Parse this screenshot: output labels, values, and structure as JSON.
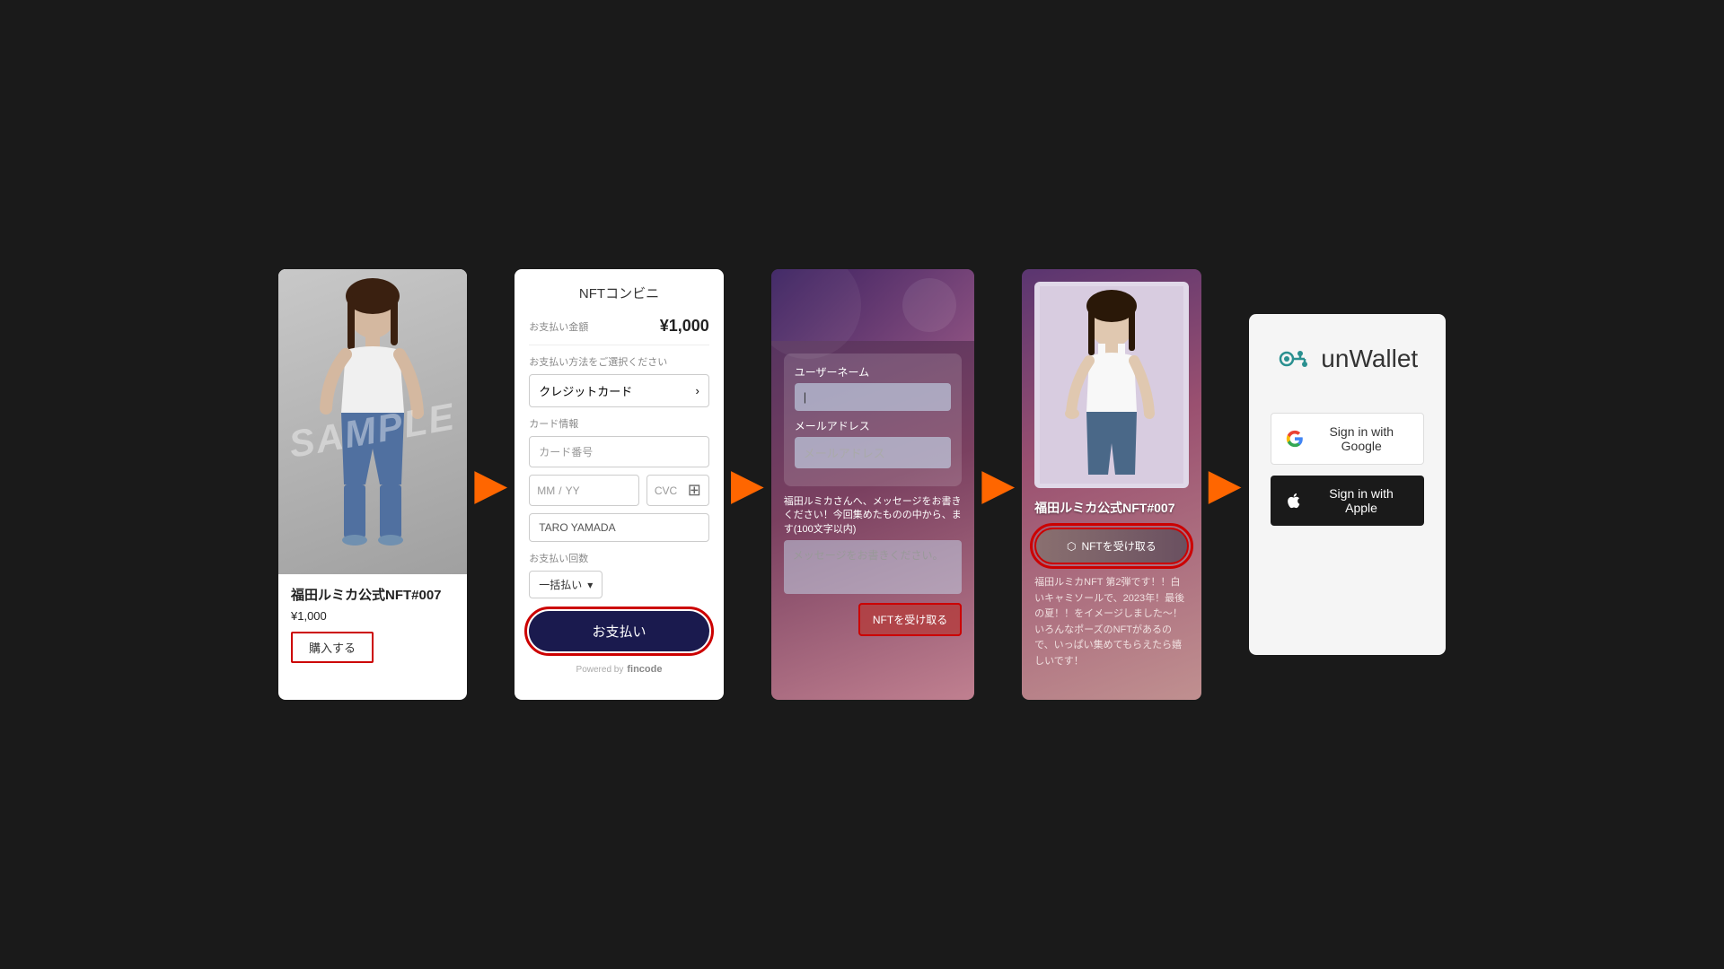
{
  "panel1": {
    "title": "福田ルミカ公式NFT#007",
    "price": "¥1,000",
    "buy_button": "購入する",
    "sample_text": "SAMPLE"
  },
  "panel2": {
    "title": "NFTコンビニ",
    "amount_label": "お支払い金額",
    "amount": "¥1,000",
    "payment_method_label": "お支払い方法をご選択ください",
    "payment_method": "クレジットカード",
    "card_info_label": "カード情報",
    "card_number_placeholder": "カード番号",
    "expiry_mm": "MM",
    "expiry_yy": "YY",
    "cvc": "CVC",
    "cardholder": "TARO YAMADA",
    "payment_count_label": "お支払い回数",
    "payment_count": "一括払い",
    "pay_button": "お支払い",
    "powered_by": "Powered by",
    "fincode": "fincode"
  },
  "panel3": {
    "username_label": "ユーザーネーム",
    "username_value": "|",
    "email_label": "メールアドレス",
    "email_placeholder": "メールアドレス",
    "message_prompt": "福田ルミカさんへ、メッセージをお書きください！今回集めたものの中から、ます(100文字以内)",
    "message_placeholder": "メッセージをお書きください。",
    "receive_button": "NFTを受け取る"
  },
  "panel4": {
    "title": "福田ルミカ公式NFT#007",
    "receive_button": "NFTを受け取る",
    "description": "福田ルミカNFT 第2弾です！！白いキャミソールで、2023年！最後の夏！！をイメージしました～！いろんなポーズのNFTがあるので、いっぱい集めてもらえたら嬉しいです！"
  },
  "panel5": {
    "logo_name": "unWallet",
    "sign_in_google": "Sign in with Google",
    "sign_in_apple": "Sign in with Apple"
  },
  "arrows": {
    "symbol": "▶"
  }
}
